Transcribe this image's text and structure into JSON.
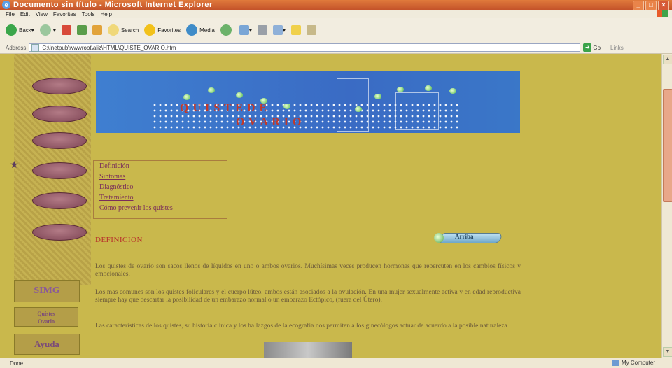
{
  "window": {
    "title": "Documento sin título - Microsoft Internet Explorer"
  },
  "menu": [
    "File",
    "Edit",
    "View",
    "Favorites",
    "Tools",
    "Help"
  ],
  "toolbar": {
    "back": "Back",
    "search": "Search",
    "favorites": "Favorites",
    "media": "Media"
  },
  "address": {
    "label": "Address",
    "url": "C:\\Inetpub\\wwwroot\\aliz\\HTML\\QUISTE_OVARIO.htm",
    "go": "Go",
    "links": "Links"
  },
  "status": {
    "text": "Done",
    "zone": "My Computer"
  },
  "banner": {
    "line1": "Q U I S T E   D E",
    "line2": "O V A R I O"
  },
  "links": [
    "Definición",
    "Síntomas",
    "Diagnóstico",
    "Tratamiento",
    "Cómo prevenir los quistes"
  ],
  "section_title": "DEFINICION",
  "arriba": "Arriba",
  "paragraphs": [
    "Los quistes de ovario son sacos llenos de líquidos en uno o ambos ovarios. Muchísimas veces producen hormonas que repercuten en los cambios físicos y emocionales.",
    "Los mas comunes son los quistes foliculares y el cuerpo lúteo, ambos están asociados a la ovulación. En una mujer sexualmente activa y en edad reproductiva siempre hay que descartar la posibilidad de un embarazo normal o un embarazo Ectópico, (fuera del Útero).",
    "Las características de los quistes, su historia clínica y los hallazgos de la ecografía nos permiten a los ginecólogos actuar de acuerdo a la posible naturaleza"
  ],
  "sidebar": {
    "simg": "SIMG",
    "quistes_line1": "Quistes",
    "quistes_line2": "Ovario",
    "ayuda": "Ayuda"
  }
}
